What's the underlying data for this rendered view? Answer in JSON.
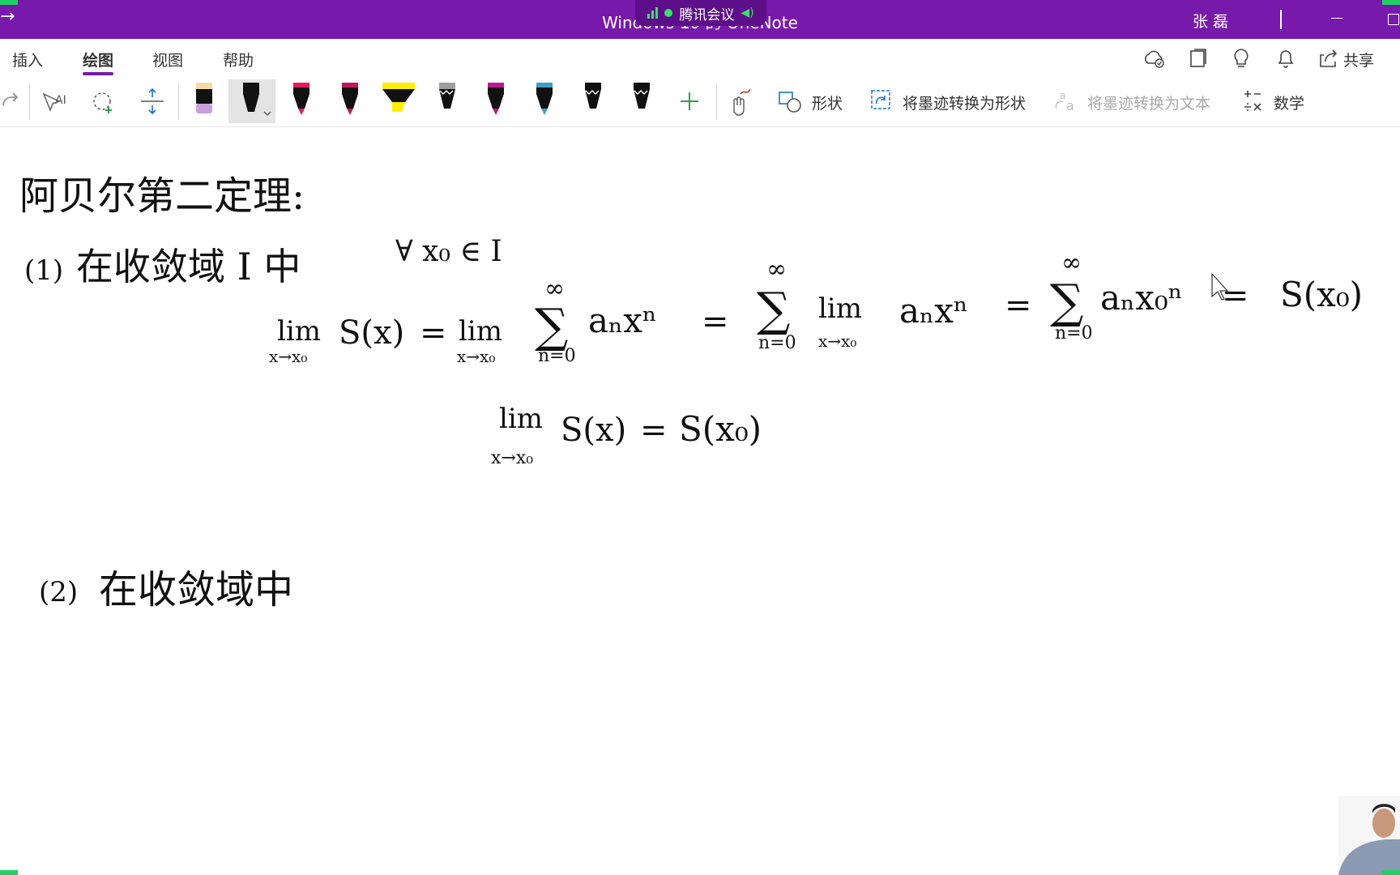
{
  "window": {
    "title": "Windows 10 的 OneNote",
    "meeting_indicator": "腾讯会议",
    "user_name": "张 磊"
  },
  "menu": {
    "tabs": [
      {
        "label": "插入"
      },
      {
        "label": "绘图",
        "active": true
      },
      {
        "label": "视图"
      },
      {
        "label": "帮助"
      }
    ],
    "share_label": "共享"
  },
  "ribbon": {
    "shapes_label": "形状",
    "ink_to_shape_label": "将墨迹转换为形状",
    "ink_to_text_label": "将墨迹转换为文本",
    "math_label": "数学",
    "pens": [
      {
        "name": "highlighter-pen",
        "color": "#c9a0dc"
      },
      {
        "name": "black-pen",
        "color": "#111111",
        "selected": true
      },
      {
        "name": "red-pen",
        "color": "#e8195a"
      },
      {
        "name": "crimson-pen",
        "color": "#c2185b"
      },
      {
        "name": "yellow-highlighter",
        "color": "#ffee00"
      },
      {
        "name": "galaxy-pen",
        "color": "#9e9e9e"
      },
      {
        "name": "magenta-pen",
        "color": "#c0168f"
      },
      {
        "name": "ocean-pen",
        "color": "#3aa0c8"
      },
      {
        "name": "black-pencil-1",
        "color": "#111111"
      },
      {
        "name": "black-pencil-2",
        "color": "#111111"
      }
    ],
    "add_pen_icon": "plus-icon"
  },
  "notes": {
    "heading": "阿贝尔第二定理:",
    "item1_prefix": "(1)",
    "item1_text": "在收敛域 I 中",
    "item1_condition": "∀ x₀ ∈ I",
    "eq1_lim": "lim",
    "eq1_sub": "x→x₀",
    "eq1_a": "S(x)",
    "eq1_eq": "=",
    "eq1_sum": "∑",
    "eq1_sum_top": "∞",
    "eq1_sum_bot": "n=0",
    "eq1_term1": "aₙxⁿ",
    "eq1_term2": "aₙxⁿ",
    "eq1_term3": "aₙx₀ⁿ",
    "eq1_result": "S(x₀)",
    "eq2_lhs": "S(x)",
    "eq2_rhs": "S(x₀)",
    "item2_prefix": "(2)",
    "item2_text": "在收敛域中"
  },
  "colors": {
    "titlebar": "#7719aa",
    "accent": "#7719aa",
    "meeting_green": "#3be06b"
  }
}
